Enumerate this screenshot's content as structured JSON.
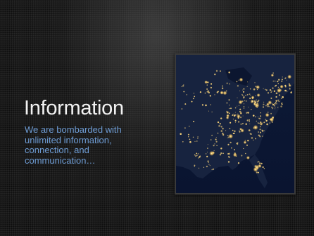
{
  "slide": {
    "title": "Information",
    "body": "We are bombarded with unlimited information, connection, and communication…"
  },
  "image": {
    "subject": "usa-night-lights-map"
  },
  "colors": {
    "title": "#f2f2f2",
    "body": "#6d9bd3",
    "background": "#1a1a1a",
    "city_lights": "#f7d27a"
  }
}
